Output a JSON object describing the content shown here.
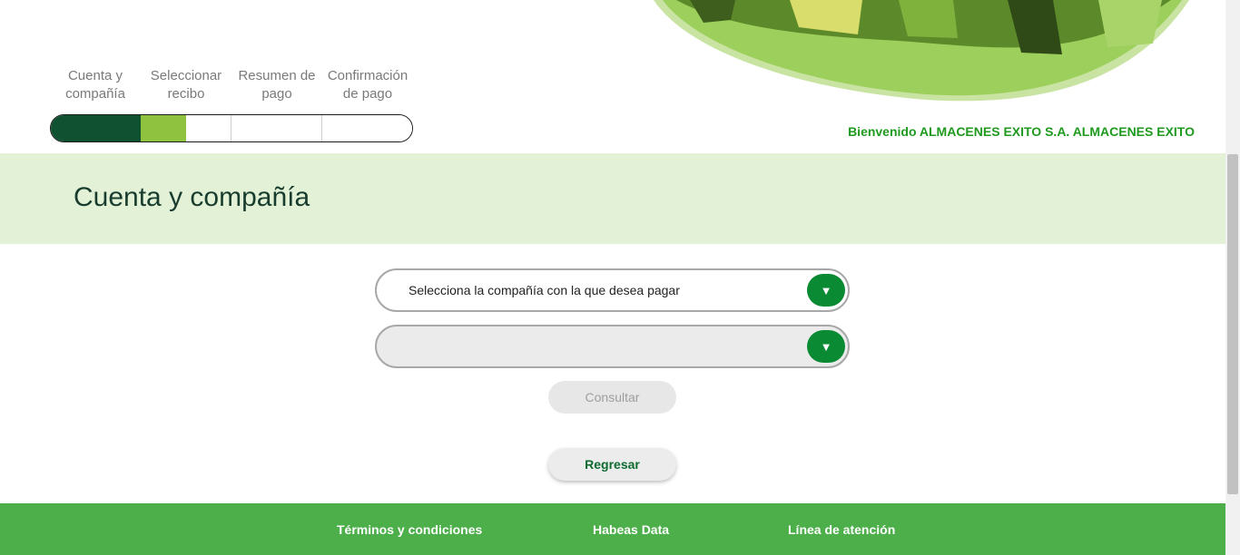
{
  "steps": [
    {
      "line1": "Cuenta y",
      "line2": "compañía"
    },
    {
      "line1": "Seleccionar",
      "line2": "recibo"
    },
    {
      "line1": "Resumen de",
      "line2": "pago"
    },
    {
      "line1": "Confirmación",
      "line2": "de pago"
    }
  ],
  "progress": {
    "current_step": 1,
    "total_steps": 4,
    "colors": {
      "done": "#0f5130",
      "active": "#8fc33f"
    }
  },
  "header": {
    "welcome": "Bienvenido ALMACENES EXITO S.A. ALMACENES EXITO"
  },
  "page": {
    "title": "Cuenta y compañía"
  },
  "form": {
    "company_select": {
      "value": "Selecciona la compañía con la que desea pagar"
    },
    "second_select": {
      "value": ""
    },
    "consult_label": "Consultar",
    "back_label": "Regresar"
  },
  "footer": {
    "links": [
      "Términos y condiciones",
      "Habeas Data",
      "Línea de atención"
    ]
  },
  "colors": {
    "brand_green": "#0b8a34",
    "footer_green": "#4caf4a",
    "title_band": "#e3f1d7"
  }
}
